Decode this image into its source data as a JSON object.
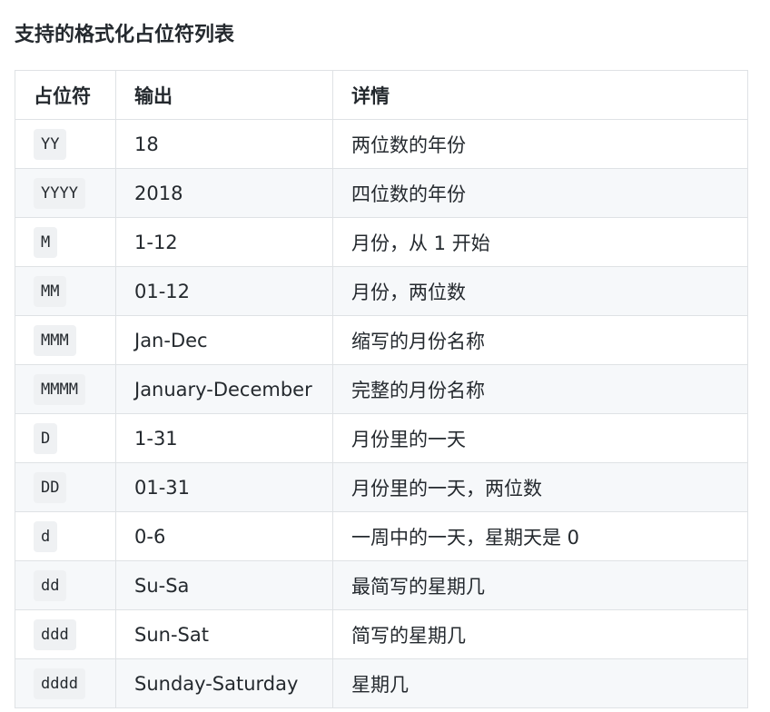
{
  "title": "支持的格式化占位符列表",
  "columns": [
    "占位符",
    "输出",
    "详情"
  ],
  "rows": [
    {
      "placeholder": "YY",
      "output": "18",
      "detail": "两位数的年份"
    },
    {
      "placeholder": "YYYY",
      "output": "2018",
      "detail": "四位数的年份"
    },
    {
      "placeholder": "M",
      "output": "1-12",
      "detail": "月份，从 1 开始"
    },
    {
      "placeholder": "MM",
      "output": "01-12",
      "detail": "月份，两位数"
    },
    {
      "placeholder": "MMM",
      "output": "Jan-Dec",
      "detail": "缩写的月份名称"
    },
    {
      "placeholder": "MMMM",
      "output": "January-December",
      "detail": "完整的月份名称"
    },
    {
      "placeholder": "D",
      "output": "1-31",
      "detail": "月份里的一天"
    },
    {
      "placeholder": "DD",
      "output": "01-31",
      "detail": "月份里的一天，两位数"
    },
    {
      "placeholder": "d",
      "output": "0-6",
      "detail": "一周中的一天，星期天是 0"
    },
    {
      "placeholder": "dd",
      "output": "Su-Sa",
      "detail": "最简写的星期几"
    },
    {
      "placeholder": "ddd",
      "output": "Sun-Sat",
      "detail": "简写的星期几"
    },
    {
      "placeholder": "dddd",
      "output": "Sunday-Saturday",
      "detail": "星期几"
    }
  ]
}
